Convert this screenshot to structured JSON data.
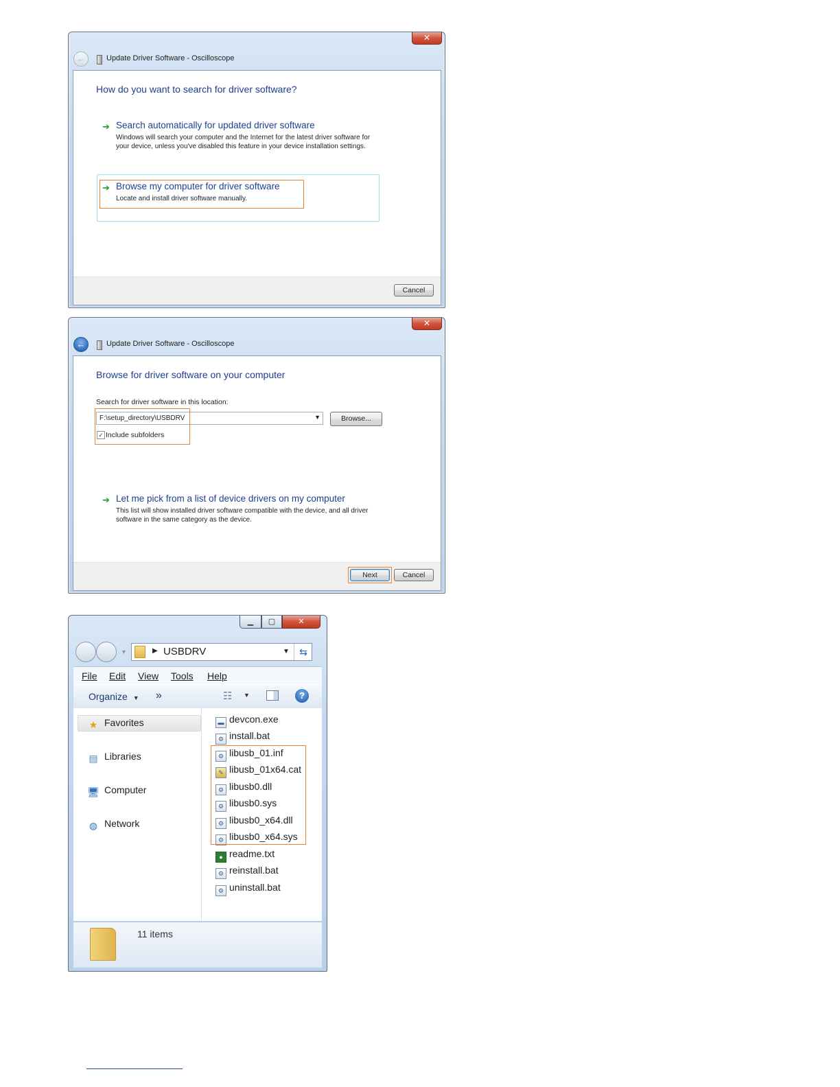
{
  "dialog1": {
    "close_label": "✕",
    "title": "Update Driver Software - Oscilloscope",
    "heading": "How do you want to search for driver software?",
    "option_auto": {
      "title": "Search automatically for updated driver software",
      "desc": "Windows will search your computer and the Internet for the latest driver software for your device, unless you've disabled this feature in your device installation settings."
    },
    "option_browse": {
      "title": "Browse my computer for driver software",
      "desc": "Locate and install driver software manually."
    },
    "cancel_label": "Cancel"
  },
  "dialog2": {
    "close_label": "✕",
    "title": "Update Driver Software - Oscilloscope",
    "heading": "Browse for driver software on your computer",
    "search_label": "Search for driver software in this location:",
    "path_value": "F:\\setup_directory\\USBDRV",
    "browse_label": "Browse...",
    "include_subfolders_label": "Include subfolders",
    "include_subfolders_checked": true,
    "option_pick": {
      "title": "Let me pick from a list of device drivers on my computer",
      "desc": "This list will show installed driver software compatible with the device, and all driver software in the same category as the device."
    },
    "next_label": "Next",
    "cancel_label": "Cancel"
  },
  "explorer": {
    "address": "USBDRV",
    "menu": [
      "File",
      "Edit",
      "View",
      "Tools",
      "Help"
    ],
    "organize_label": "Organize",
    "more_label": "»",
    "nav": [
      "Favorites",
      "Libraries",
      "Computer",
      "Network"
    ],
    "files": [
      {
        "name": "devcon.exe",
        "icon": "exe-icon"
      },
      {
        "name": "install.bat",
        "icon": "batch-icon"
      },
      {
        "name": "libusb_01.inf",
        "icon": "setup-info-icon"
      },
      {
        "name": "libusb_01x64.cat",
        "icon": "security-catalog-icon"
      },
      {
        "name": "libusb0.dll",
        "icon": "dll-icon"
      },
      {
        "name": "libusb0.sys",
        "icon": "system-file-icon"
      },
      {
        "name": "libusb0_x64.dll",
        "icon": "dll-icon"
      },
      {
        "name": "libusb0_x64.sys",
        "icon": "system-file-icon"
      },
      {
        "name": "readme.txt",
        "icon": "text-file-icon"
      },
      {
        "name": "reinstall.bat",
        "icon": "batch-icon"
      },
      {
        "name": "uninstall.bat",
        "icon": "batch-icon"
      }
    ],
    "item_count": "11 items"
  },
  "colors": {
    "highlight": "#f0822f",
    "heading_blue": "#1d3f8f",
    "arrow_green": "#1a9c2a"
  }
}
